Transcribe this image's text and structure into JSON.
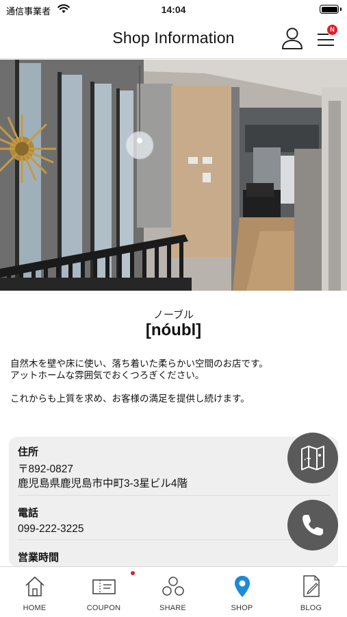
{
  "status_bar": {
    "carrier": "通信事業者",
    "time": "14:04"
  },
  "header": {
    "title": "Shop Information",
    "notification_badge": "N"
  },
  "shop": {
    "name_kana": "ノーブル",
    "name": "[nóubl]",
    "description_lines": [
      "自然木を壁や床に使い、落ち着いた柔らかい空間のお店です。",
      "アットホームな雰囲気でおくつろぎください。",
      "これからも上質を求め、お客様の満足を提供し続けます。"
    ]
  },
  "info": {
    "address_label": "住所",
    "postal_code": "〒892-0827",
    "address": "鹿児島県鹿児島市中町3-3星ビル4階",
    "phone_label": "電話",
    "phone": "099-222-3225",
    "hours_label": "営業時間"
  },
  "tabs": [
    {
      "label": "HOME",
      "icon": "home-icon",
      "active": false
    },
    {
      "label": "COUPON",
      "icon": "coupon-icon",
      "active": false,
      "has_dot": true
    },
    {
      "label": "SHARE",
      "icon": "share-icon",
      "active": false
    },
    {
      "label": "SHOP",
      "icon": "location-pin-icon",
      "active": true
    },
    {
      "label": "BLOG",
      "icon": "blog-icon",
      "active": false
    }
  ],
  "colors": {
    "accent_blue": "#1e8ad6",
    "badge_red": "#e0202b",
    "fab_gray": "#5a5a5a",
    "card_bg": "#efefef"
  }
}
